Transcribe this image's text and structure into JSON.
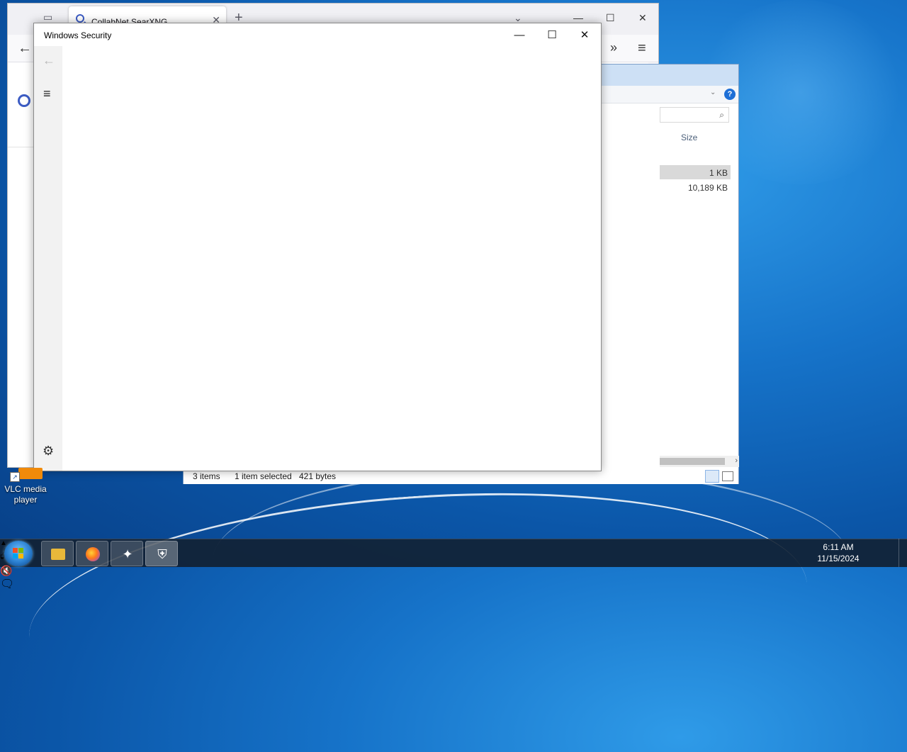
{
  "browser": {
    "tab_title": "CollabNet SearXNG",
    "new_tab_icon": "+",
    "tab_close": "✕",
    "minimize": "—",
    "maximize": "☐",
    "close": "✕"
  },
  "explorer": {
    "column_size": "Size",
    "rows": [
      {
        "size": "1 KB"
      },
      {
        "size": "10,189 KB"
      }
    ],
    "status": {
      "items": "3 items",
      "selected": "1 item selected",
      "bytes": "421 bytes"
    }
  },
  "windows_security": {
    "title": "Windows Security",
    "minimize": "—",
    "maximize": "☐",
    "close": "✕"
  },
  "desktop": {
    "vlc_label": "VLC media player"
  },
  "taskbar": {
    "time": "6:11 AM",
    "date": "11/15/2024",
    "apps": [
      "file-explorer",
      "firefox",
      "pinned-app",
      "windows-security"
    ]
  },
  "colors": {
    "accent": "#1e6fd6",
    "desktop": "#1673c9"
  }
}
